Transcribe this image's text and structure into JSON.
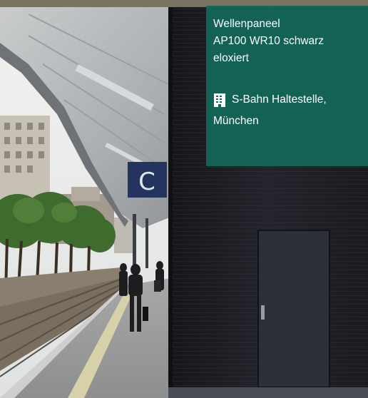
{
  "info": {
    "product_line1": "Wellenpaneel",
    "product_line2": "AP100 WR10 schwarz",
    "product_line3": "eloxiert",
    "location_icon": "building-icon",
    "location_line1": "S-Bahn Haltestelle,",
    "location_line2": "München"
  },
  "signage": {
    "platform_letter": "C"
  },
  "colors": {
    "overlay_green": "#12685A",
    "wall_black": "#1d1e24",
    "sign_blue": "#23345e"
  }
}
